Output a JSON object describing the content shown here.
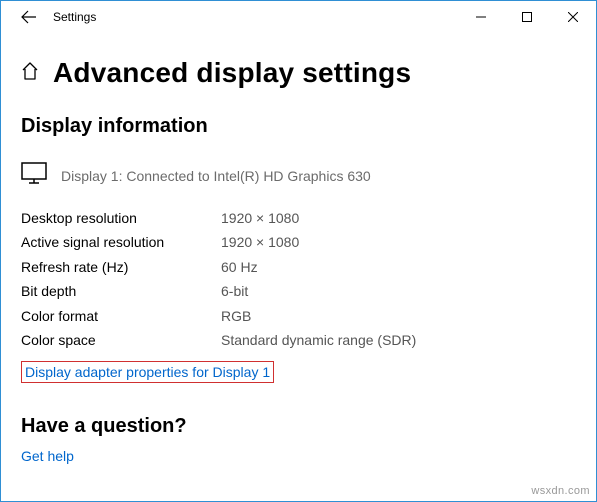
{
  "titlebar": {
    "title": "Settings"
  },
  "header": {
    "title": "Advanced display settings"
  },
  "section_info": {
    "title": "Display information",
    "display_desc": "Display 1: Connected to Intel(R) HD Graphics 630",
    "rows": {
      "desktop_res_label": "Desktop resolution",
      "desktop_res_value": "1920 × 1080",
      "active_res_label": "Active signal resolution",
      "active_res_value": "1920 × 1080",
      "refresh_label": "Refresh rate (Hz)",
      "refresh_value": "60 Hz",
      "bitdepth_label": "Bit depth",
      "bitdepth_value": "6-bit",
      "colorformat_label": "Color format",
      "colorformat_value": "RGB",
      "colorspace_label": "Color space",
      "colorspace_value": "Standard dynamic range (SDR)"
    },
    "adapter_link": "Display adapter properties for Display 1"
  },
  "question": {
    "title": "Have a question?",
    "help_link": "Get help"
  },
  "watermark": "wsxdn.com"
}
